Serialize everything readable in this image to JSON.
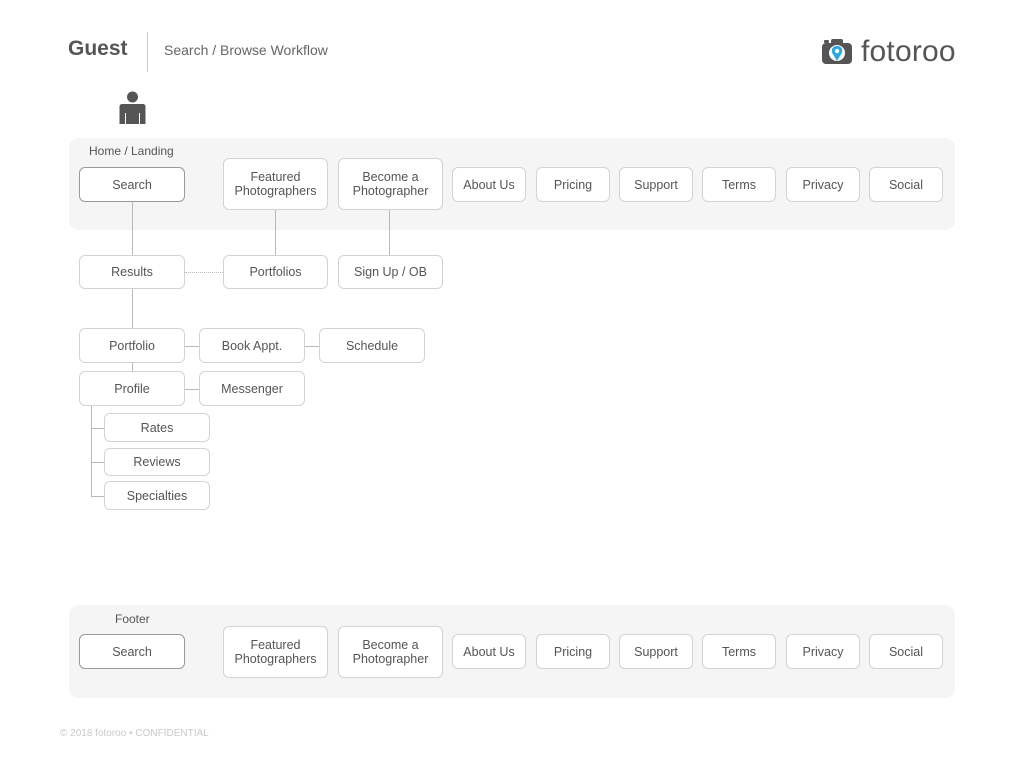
{
  "header": {
    "title": "Guest",
    "subtitle": "Search / Browse Workflow",
    "logo_text": "fotoroo"
  },
  "icons": {
    "user": "user-person-icon",
    "camera": "camera-pin-icon"
  },
  "colors": {
    "panel_background": "#f5f5f5",
    "node_border": "#d3d3d3",
    "connector": "#b9b9b9",
    "logo_pin": "#2aa8e0"
  },
  "landing": {
    "label": "Home / Landing",
    "nav": [
      "Search",
      "Featured\nPhotographers",
      "Become a\nPhotographer",
      "About Us",
      "Pricing",
      "Support",
      "Terms",
      "Privacy",
      "Social"
    ]
  },
  "flow": {
    "results": "Results",
    "portfolios": "Portfolios",
    "signup": "Sign Up / OB",
    "portfolio": "Portfolio",
    "book": "Book Appt.",
    "schedule": "Schedule",
    "profile": "Profile",
    "messenger": "Messenger",
    "rates": "Rates",
    "reviews": "Reviews",
    "specialties": "Specialties"
  },
  "footer": {
    "label": "Footer",
    "nav": [
      "Search",
      "Featured\nPhotographers",
      "Become a\nPhotographer",
      "About Us",
      "Pricing",
      "Support",
      "Terms",
      "Privacy",
      "Social"
    ]
  },
  "copyright": "© 2018 fotoroo • CONFIDENTIAL"
}
